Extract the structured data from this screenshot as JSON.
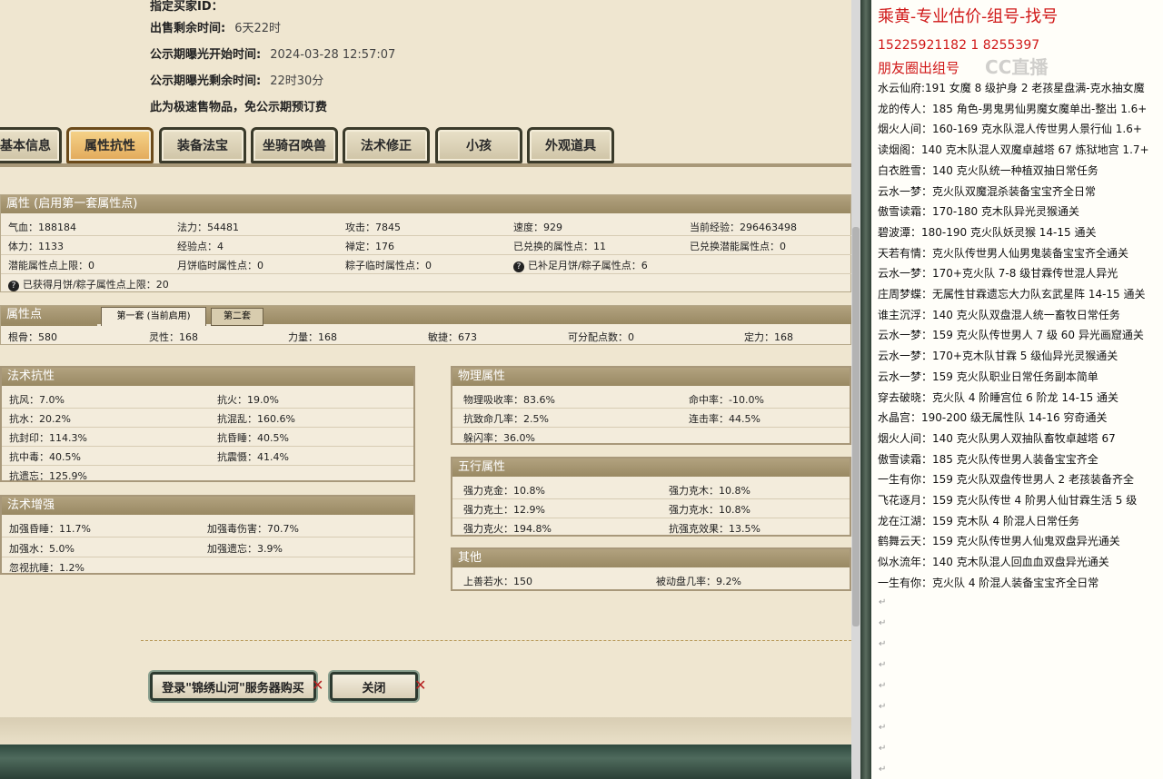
{
  "header": {
    "rows": [
      {
        "label": "指定买家ID：",
        "value": ""
      },
      {
        "label": "出售剩余时间:",
        "value": "6天22时"
      },
      {
        "label": "公示期曝光开始时间:",
        "value": "2024-03-28 12:57:07"
      },
      {
        "label": "公示期曝光剩余时间:",
        "value": "22时30分"
      },
      {
        "label": "此为极速售物品，免公示期预订费",
        "value": ""
      }
    ]
  },
  "tabs": [
    "基本信息",
    "属性抗性",
    "装备法宝",
    "坐骑召唤兽",
    "法术修正",
    "小孩",
    "外观道具"
  ],
  "active_tab": 1,
  "attributes": {
    "title": "属性 (启用第一套属性点)",
    "rows": [
      [
        "气血：188184",
        "法力：54481",
        "攻击：7845",
        "速度：929",
        "当前经验：296463498"
      ],
      [
        "体力：1133",
        "经验点：4",
        "禅定：176",
        "已兑换的属性点：11",
        "已兑换潜能属性点：0"
      ],
      [
        "潜能属性点上限：0",
        "月饼临时属性点：0",
        "粽子临时属性点：0",
        "已补足月饼/粽子属性点：6",
        ""
      ],
      [
        "已获得月饼/粽子属性点上限：20",
        "",
        "",
        "",
        ""
      ]
    ]
  },
  "points": {
    "title": "属性点",
    "tab1": "第一套 (当前启用)",
    "tab2": "第二套",
    "values": [
      "根骨：580",
      "灵性：168",
      "力量：168",
      "敏捷：673",
      "可分配点数：0",
      "定力：168"
    ]
  },
  "spell_resist": {
    "title": "法术抗性",
    "rows": [
      [
        "抗风：7.0%",
        "抗火：19.0%"
      ],
      [
        "抗水：20.2%",
        "抗混乱：160.6%"
      ],
      [
        "抗封印：114.3%",
        "抗昏睡：40.5%"
      ],
      [
        "抗中毒：40.5%",
        "抗震慑：41.4%"
      ],
      [
        "抗遗忘：125.9%",
        ""
      ]
    ]
  },
  "spell_boost": {
    "title": "法术增强",
    "rows": [
      [
        "加强昏睡：11.7%",
        "加强毒伤害：70.7%"
      ],
      [
        "加强水：5.0%",
        "加强遗忘：3.9%"
      ],
      [
        "忽视抗睡：1.2%",
        ""
      ]
    ]
  },
  "physical": {
    "title": "物理属性",
    "rows": [
      [
        "物理吸收率：83.6%",
        "命中率：-10.0%"
      ],
      [
        "抗致命几率：2.5%",
        "连击率：44.5%"
      ],
      [
        "躲闪率：36.0%",
        ""
      ]
    ]
  },
  "elements": {
    "title": "五行属性",
    "rows": [
      [
        "强力克金：10.8%",
        "强力克木：10.8%"
      ],
      [
        "强力克土：12.9%",
        "强力克水：10.8%"
      ],
      [
        "强力克火：194.8%",
        "抗强克效果：13.5%"
      ]
    ]
  },
  "other": {
    "title": "其他",
    "rows": [
      [
        "上善若水：150",
        "被动盘几率：9.2%"
      ]
    ]
  },
  "buttons": {
    "login": "登录\"锦绣山河\"服务器购买",
    "close": "关闭"
  },
  "colors": {
    "accent_red": "#d01818",
    "panel_header": "#a8987a"
  },
  "note": {
    "title": "乘黄-专业估价-组号-找号",
    "phone": "15225921182    1  8255397",
    "subtitle": "朋友圈出组号",
    "watermark": "CC直播",
    "lines": [
      "水云仙府:191 女魔 8 级护身 2 老孩星盘满-克水抽女魔",
      "龙的传人：185 角色-男鬼男仙男魔女魔单出-整出 1.6+",
      "烟火人间：160-169 克水队混人传世男人景行仙 1.6+",
      "读烟阁：140 克木队混人双魔卓越塔 67 炼狱地宫 1.7+",
      "白衣胜雪：140 克火队统一种植双抽日常任务",
      "云水一梦：克火队双魔混杀装备宝宝齐全日常",
      "傲雪读霜：170-180 克木队异光灵猴通关",
      "碧波潭：180-190 克火队妖灵猴 14-15 通关",
      "天若有情：克火队传世男人仙男鬼装备宝宝齐全通关",
      "云水一梦：170+克火队 7-8 级甘霖传世混人异光",
      "庄周梦蝶：无属性甘霖遗忘大力队玄武星阵 14-15 通关",
      "谁主沉浮：140 克火队双盘混人统一畜牧日常任务",
      "云水一梦：159 克火队传世男人 7 级 60 异光画窟通关",
      "云水一梦：170+克木队甘霖 5 级仙异光灵猴通关",
      "云水一梦：159 克火队职业日常任务副本简单",
      "穿去破晓：克火队 4 阶睡宫位 6 阶龙 14-15 通关",
      "水晶宫：190-200 级无属性队 14-16 穷奇通关",
      "烟火人间：140 克火队男人双抽队畜牧卓越塔 67",
      "傲雪读霜：185 克火队传世男人装备宝宝齐全",
      "一生有你：159 克火队双盘传世男人 2 老孩装备齐全",
      "飞花逐月：159 克火队传世 4 阶男人仙甘霖生活 5 级",
      "龙在江湖：159 克木队 4 阶混人日常任务",
      "鹤舞云天：159 克火队传世男人仙鬼双盘异光通关",
      "似水流年：140 克木队混人回血血双盘异光通关",
      "一生有你：克火队 4 阶混人装备宝宝齐全日常"
    ]
  }
}
